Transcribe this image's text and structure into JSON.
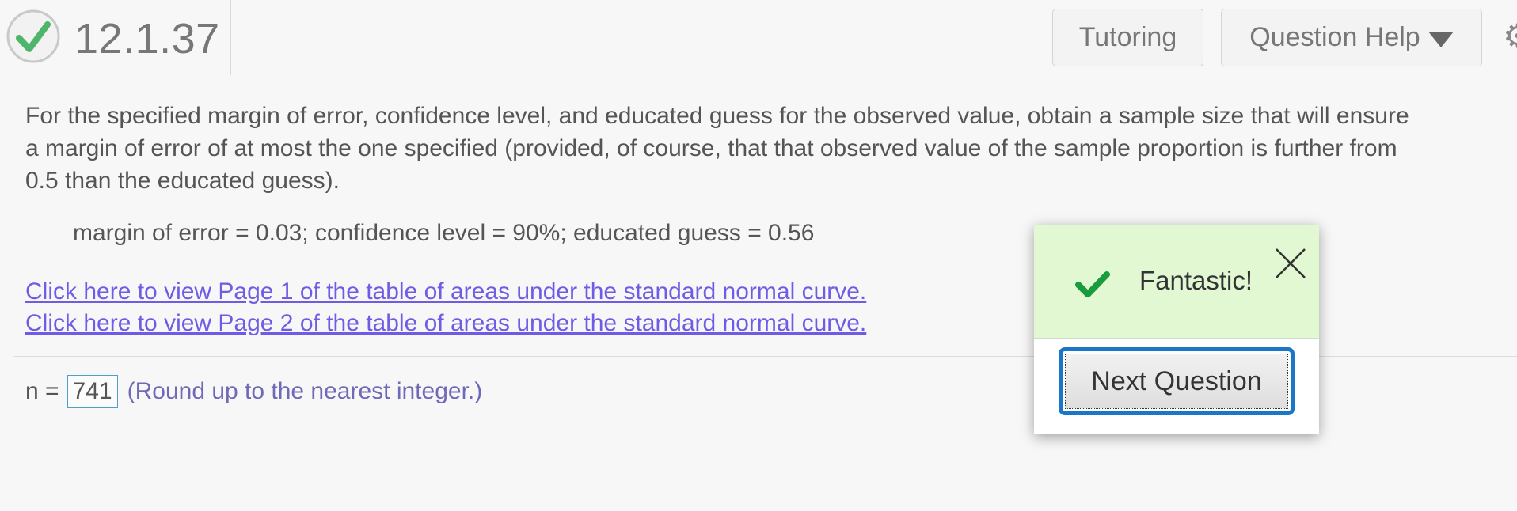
{
  "header": {
    "question_number": "12.1.37",
    "tutoring_label": "Tutoring",
    "question_help_label": "Question Help"
  },
  "problem": {
    "line1": "For the specified margin of error, confidence level, and educated guess for the observed value, obtain a sample size that will ensure",
    "line2": "a margin of error of at most the one specified (provided, of course, that that observed value of the sample proportion is further from",
    "line3": "0.5 than the educated guess).",
    "given": "margin of error = 0.03; confidence level = 90%; educated guess = 0.56",
    "link1": "Click here to view Page 1 of the table of areas under the standard normal curve.",
    "link2": "Click here to view Page 2 of the table of areas under the standard normal curve."
  },
  "answer": {
    "label": "n =",
    "value": "741",
    "hint": "(Round up to the nearest integer.)"
  },
  "popup": {
    "message": "Fantastic!",
    "next_label": "Next Question"
  },
  "colors": {
    "correct_green": "#1a9b3c",
    "link": "#6f5ce6",
    "focus_blue": "#1976c9",
    "popup_bg": "#e1f8d3"
  },
  "icons": {
    "status": "correct-check-circle-icon",
    "dropdown": "caret-down-icon",
    "settings": "gear-icon",
    "popup_check": "checkmark-icon",
    "close": "close-icon"
  }
}
